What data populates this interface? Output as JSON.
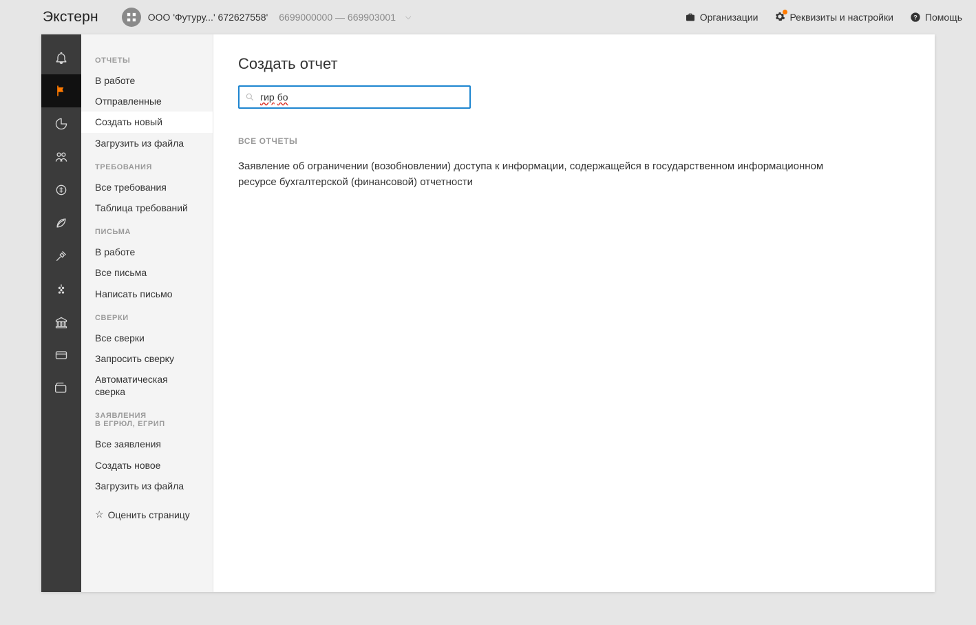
{
  "header": {
    "logo": "Экстерн",
    "org_name": "ООО 'Футуру...' 672627558'",
    "org_secondary": "6699000000 — 669903001",
    "links": {
      "organizations": "Организации",
      "settings": "Реквизиты и настройки",
      "help": "Помощь"
    }
  },
  "iconbar": [
    {
      "name": "bell-icon"
    },
    {
      "name": "flag-icon",
      "active": true
    },
    {
      "name": "pie-icon"
    },
    {
      "name": "people-icon"
    },
    {
      "name": "coin-icon"
    },
    {
      "name": "leaf-icon"
    },
    {
      "name": "tools-icon"
    },
    {
      "name": "grapes-icon"
    },
    {
      "name": "bank-icon"
    },
    {
      "name": "card-icon"
    },
    {
      "name": "wallet-icon"
    }
  ],
  "sidebar": {
    "groups": [
      {
        "title": "ОТЧЕТЫ",
        "items": [
          {
            "label": "В работе"
          },
          {
            "label": "Отправленные"
          },
          {
            "label": "Создать новый",
            "selected": true
          },
          {
            "label": "Загрузить из файла"
          }
        ]
      },
      {
        "title": "ТРЕБОВАНИЯ",
        "items": [
          {
            "label": "Все требования"
          },
          {
            "label": "Таблица требований"
          }
        ]
      },
      {
        "title": "ПИСЬМА",
        "items": [
          {
            "label": "В работе"
          },
          {
            "label": "Все письма"
          },
          {
            "label": "Написать письмо"
          }
        ]
      },
      {
        "title": "СВЕРКИ",
        "items": [
          {
            "label": "Все сверки"
          },
          {
            "label": "Запросить сверку"
          },
          {
            "label": "Автоматическая сверка"
          }
        ]
      },
      {
        "title": "ЗАЯВЛЕНИЯ В ЕГРЮЛ, ЕГРИП",
        "items": [
          {
            "label": "Все заявления"
          },
          {
            "label": "Создать новое"
          },
          {
            "label": "Загрузить из файла"
          }
        ]
      }
    ],
    "rate": "Оценить страницу"
  },
  "main": {
    "title": "Создать отчет",
    "search_w1": "гир",
    "search_w2": "бо",
    "all_reports_label": "ВСЕ ОТЧЕТЫ",
    "result": "Заявление об ограничении (возобновлении) доступа к информации, содержащейся в государственном информационном ресурсе бухгалтерской (финансовой) отчетности"
  }
}
